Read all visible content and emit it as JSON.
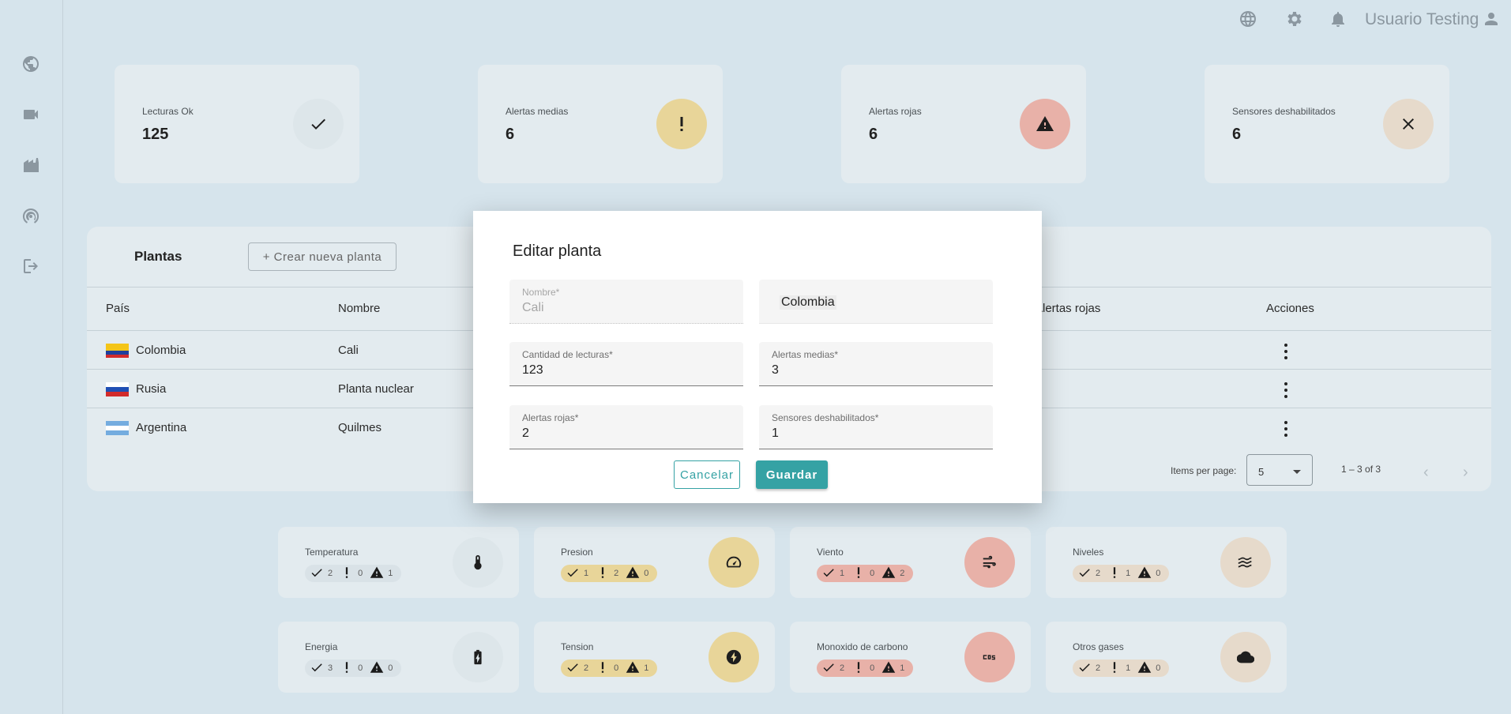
{
  "user": {
    "name": "Usuario Testing"
  },
  "stats": [
    {
      "label": "Lecturas Ok",
      "value": "125",
      "icon": "check-icon",
      "color": "#dde6ea"
    },
    {
      "label": "Alertas medias",
      "value": "6",
      "icon": "exclamation-icon",
      "color": "#e8d599"
    },
    {
      "label": "Alertas rojas",
      "value": "6",
      "icon": "warning-triangle-icon",
      "color": "#e8b1a8"
    },
    {
      "label": "Sensores deshabilitados",
      "value": "6",
      "icon": "close-icon",
      "color": "#e6dacb"
    }
  ],
  "plantas": {
    "title": "Plantas",
    "create_label": "+ Crear nueva planta",
    "columns": {
      "pais": "País",
      "nombre": "Nombre",
      "alertas_rojas": "Alertas rojas",
      "acciones": "Acciones"
    },
    "rows": [
      {
        "pais": "Colombia",
        "nombre": "Cali",
        "flag": "colombia"
      },
      {
        "pais": "Rusia",
        "nombre": "Planta nuclear",
        "flag": "rusia"
      },
      {
        "pais": "Argentina",
        "nombre": "Quilmes",
        "flag": "argentina"
      }
    ],
    "paginator": {
      "items_label": "Items per page:",
      "page_size": "5",
      "range": "1 – 3 of 3"
    }
  },
  "sensors": [
    {
      "label": "Temperatura",
      "ok": "2",
      "medias": "0",
      "rojas": "1",
      "icon": "thermometer-icon",
      "badge": "#dde6ea",
      "pill": "#d9e2e7"
    },
    {
      "label": "Presion",
      "ok": "1",
      "medias": "2",
      "rojas": "0",
      "icon": "gauge-icon",
      "badge": "#e8d599",
      "pill": "#e8d599"
    },
    {
      "label": "Viento",
      "ok": "1",
      "medias": "0",
      "rojas": "2",
      "icon": "wind-icon",
      "badge": "#e8b1a8",
      "pill": "#e8b1a8"
    },
    {
      "label": "Niveles",
      "ok": "2",
      "medias": "1",
      "rojas": "0",
      "icon": "waves-icon",
      "badge": "#e6dacb",
      "pill": "#e6dacb"
    },
    {
      "label": "Energia",
      "ok": "3",
      "medias": "0",
      "rojas": "0",
      "icon": "battery-icon",
      "badge": "#dde6ea",
      "pill": "#d9e2e7"
    },
    {
      "label": "Tension",
      "ok": "2",
      "medias": "0",
      "rojas": "1",
      "icon": "bolt-icon",
      "badge": "#e8d599",
      "pill": "#e8d599"
    },
    {
      "label": "Monoxido de carbono",
      "ok": "2",
      "medias": "0",
      "rojas": "1",
      "icon": "co2-icon",
      "badge": "#e8b1a8",
      "pill": "#e8b1a8"
    },
    {
      "label": "Otros gases",
      "ok": "2",
      "medias": "1",
      "rojas": "0",
      "icon": "cloud-icon",
      "badge": "#e6dacb",
      "pill": "#e6dacb"
    }
  ],
  "dialog": {
    "title": "Editar planta",
    "nombre": {
      "label": "Nombre*",
      "value": "Cali"
    },
    "pais": {
      "value": "Colombia"
    },
    "lecturas": {
      "label": "Cantidad de lecturas*",
      "value": "123"
    },
    "medias": {
      "label": "Alertas medias*",
      "value": "3"
    },
    "rojas": {
      "label": "Alertas rojas*",
      "value": "2"
    },
    "deshabilitados": {
      "label": "Sensores deshabilitados*",
      "value": "1"
    },
    "cancel_label": "Cancelar",
    "save_label": "Guardar"
  },
  "accent": "#35a2a4"
}
